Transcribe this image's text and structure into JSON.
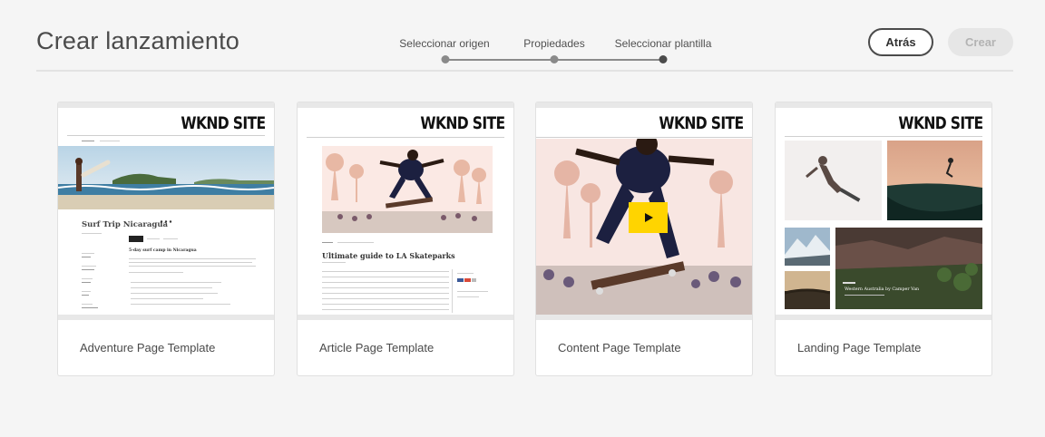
{
  "header": {
    "title": "Crear lanzamiento",
    "back_label": "Atrás",
    "create_label": "Crear"
  },
  "stepper": {
    "steps": [
      {
        "label": "Seleccionar origen",
        "state": "done"
      },
      {
        "label": "Propiedades",
        "state": "done"
      },
      {
        "label": "Seleccionar plantilla",
        "state": "current"
      }
    ]
  },
  "cards": [
    {
      "label": "Adventure Page Template",
      "logo": "WKND SITE",
      "headline": "Surf Trip Nicaragua",
      "subheadline": "5-day surf camp in Nicaragua"
    },
    {
      "label": "Article Page Template",
      "logo": "WKND SITE",
      "headline": "Ultimate guide to LA Skateparks"
    },
    {
      "label": "Content Page Template",
      "logo": "WKND SITE"
    },
    {
      "label": "Landing Page Template",
      "logo": "WKND SITE",
      "caption": "Western Australia by Camper Van"
    }
  ],
  "colors": {
    "background": "#f5f5f5",
    "accent_yellow": "#ffd400",
    "primary_text": "#323232",
    "disabled_button": "#e6e6e6"
  }
}
